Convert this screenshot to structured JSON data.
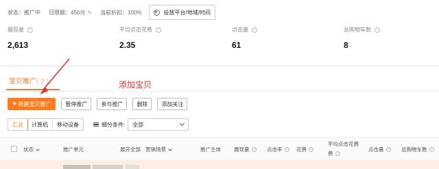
{
  "status_bar": {
    "status": "状态：推广中",
    "daily_budget": "日限额：450元",
    "discount": "当前折扣：100%",
    "platform_button": "投放平台/地域/时间"
  },
  "metrics": [
    {
      "label": "展现量",
      "value": "2,613"
    },
    {
      "label": "平均点击花费",
      "value": "2.35"
    },
    {
      "label": "点击量",
      "value": "61"
    },
    {
      "label": "总购物车数",
      "value": "8"
    }
  ],
  "tab": {
    "label": "宝贝推广",
    "count": "( 2 )"
  },
  "annotation": "添加宝贝",
  "toolbar": {
    "new_label": "新建宝贝推广",
    "pause_label": "暂停推广",
    "join_label": "参与推广",
    "delete_label": "删除",
    "follow_label": "添加关注"
  },
  "filter": {
    "segments": [
      "汇总",
      "计算机",
      "移动设备"
    ],
    "condition_label": "细分条件:",
    "select_value": "全部"
  },
  "table_header": {
    "status": "状态",
    "unit": "推广单元",
    "expand": "展开全部",
    "scene": "营销场景",
    "subject": "推广主体",
    "impressions": "展现量",
    "ctr": "点击率",
    "cost": "花费",
    "avg_cpc_line1": "平均点击花费",
    "avg_cpc_line2": "费",
    "clicks": "点击量",
    "carts": "总购物车数"
  },
  "colors": {
    "accent": "#f07b2b",
    "primary_button": "#ff7a1a",
    "annotation": "#dd3333"
  }
}
